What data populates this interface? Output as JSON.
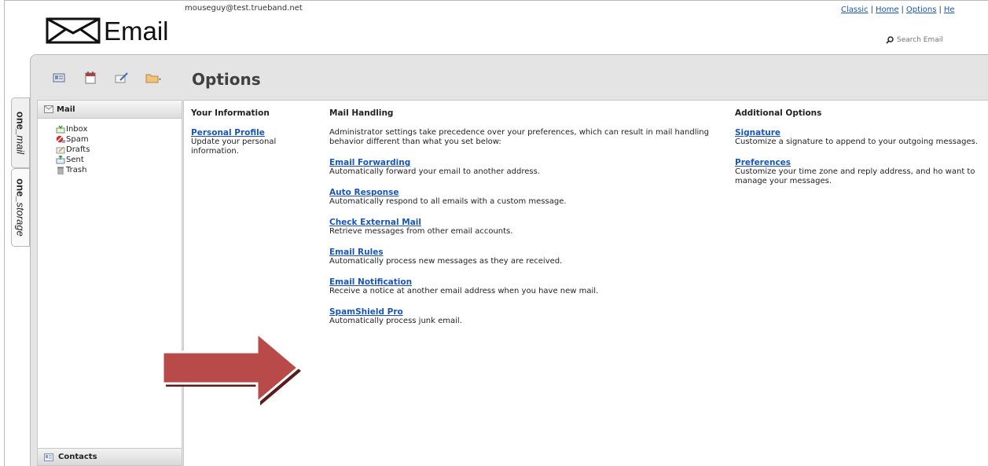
{
  "header": {
    "logo_text": "Email",
    "user_email": "mouseguy@test.trueband.net",
    "top_links": [
      "Classic",
      "Home",
      "Options",
      "He"
    ],
    "search_placeholder": "Search Email"
  },
  "vertical_tabs": [
    {
      "bold": "one",
      "rest": "_mail"
    },
    {
      "bold": "one",
      "rest": "_storage"
    }
  ],
  "toolbar": {
    "icons": [
      "address-book-icon",
      "calendar-icon",
      "compose-icon",
      "folder-icon"
    ]
  },
  "page_title": "Options",
  "sidebar": {
    "header_label": "Mail",
    "folders": [
      {
        "label": "Inbox",
        "icon": "inbox-icon"
      },
      {
        "label": "Spam",
        "icon": "spam-icon"
      },
      {
        "label": "Drafts",
        "icon": "drafts-icon"
      },
      {
        "label": "Sent",
        "icon": "sent-icon"
      },
      {
        "label": "Trash",
        "icon": "trash-icon"
      }
    ],
    "footer_label": "Contacts"
  },
  "your_information": {
    "heading": "Your Information",
    "items": [
      {
        "link": "Personal Profile",
        "desc": "Update your personal information."
      }
    ]
  },
  "mail_handling": {
    "heading": "Mail Handling",
    "intro": "Administrator settings take precedence over your preferences, which can result in mail handling behavior different than what you set below:",
    "items": [
      {
        "link": "Email Forwarding",
        "desc": "Automatically forward your email to another address."
      },
      {
        "link": "Auto Response",
        "desc": "Automatically respond to all emails with a custom message."
      },
      {
        "link": "Check External Mail",
        "desc": "Retrieve messages from other email accounts."
      },
      {
        "link": "Email Rules",
        "desc": "Automatically process new messages as they are received."
      },
      {
        "link": "Email Notification",
        "desc": "Receive a notice at another email address when you have new mail."
      },
      {
        "link": "SpamShield Pro",
        "desc": "Automatically process junk email."
      }
    ]
  },
  "additional_options": {
    "heading": "Additional Options",
    "items": [
      {
        "link": "Signature",
        "desc": "Customize a signature to append to your outgoing messages."
      },
      {
        "link": "Preferences",
        "desc": "Customize your time zone and reply address, and ho want to manage your messages."
      }
    ]
  },
  "colors": {
    "link": "#1a56b5",
    "arrow": "#b94a4a",
    "panel_bg": "#e4e4e4"
  }
}
